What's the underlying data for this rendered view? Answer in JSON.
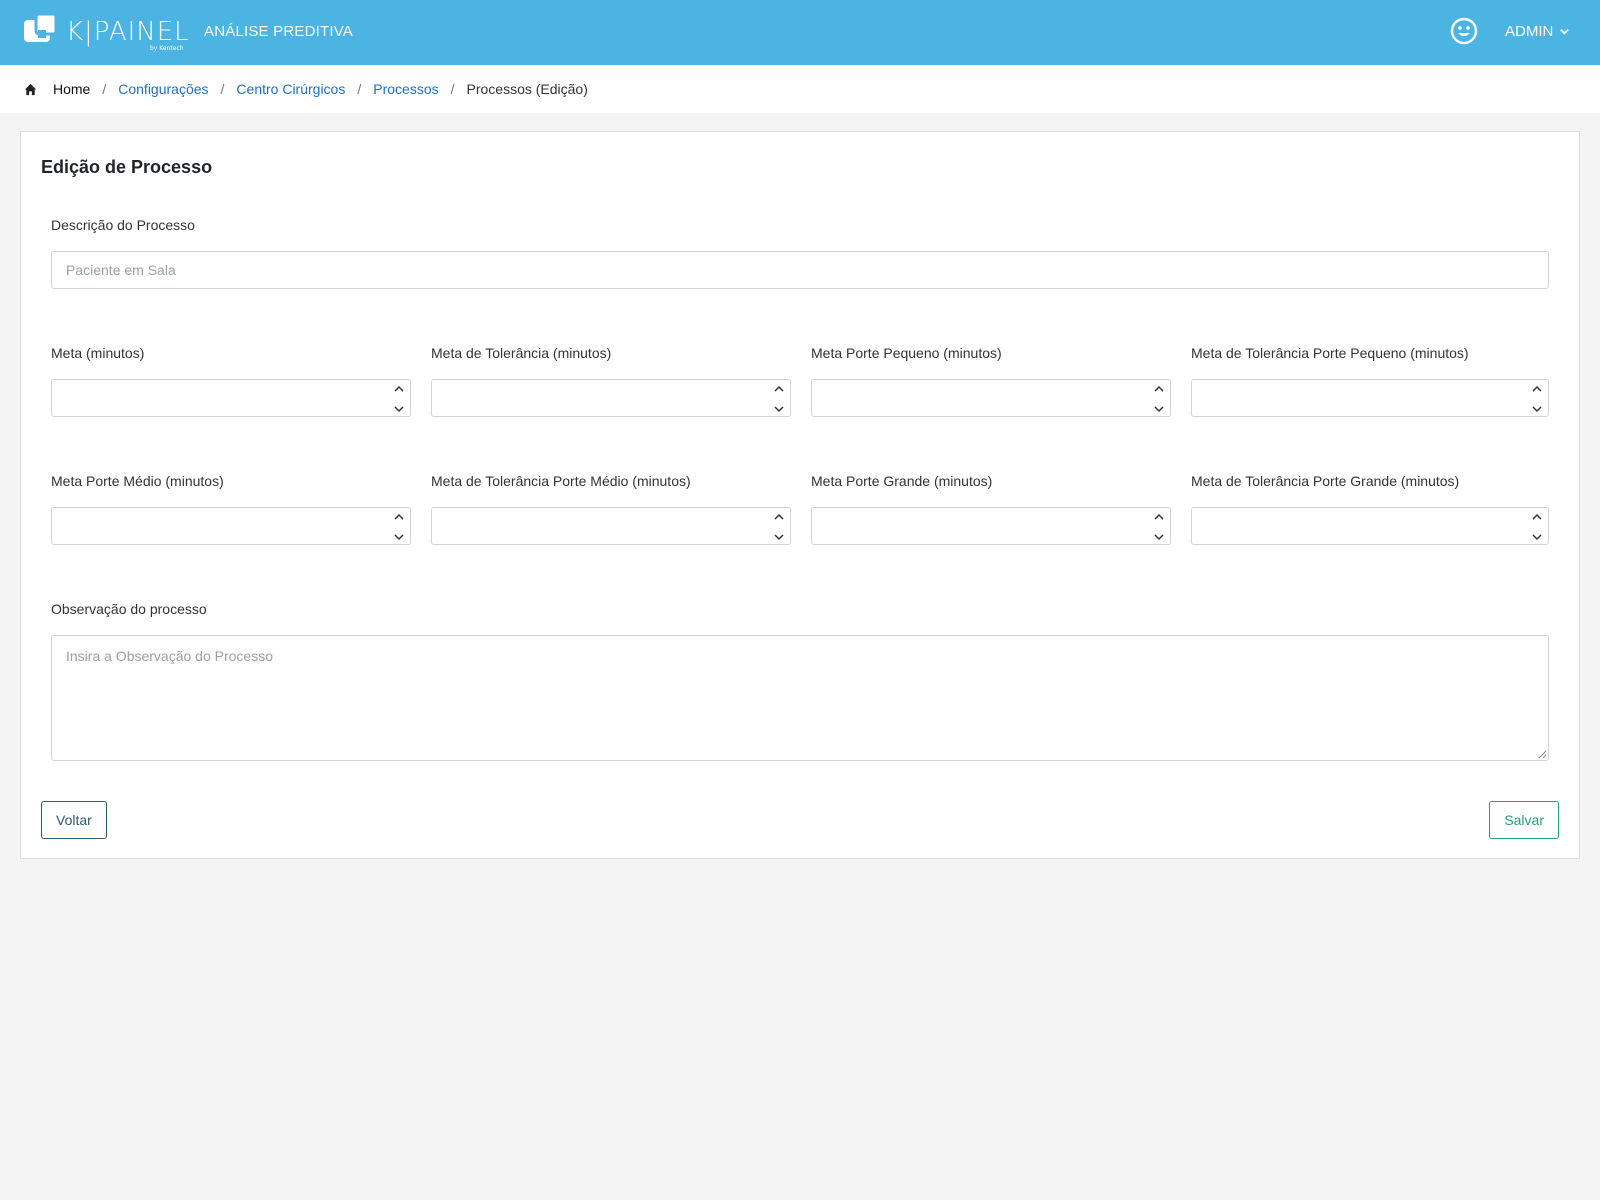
{
  "header": {
    "logo_text": "K|PAINEL",
    "logo_sub": "by Kentech",
    "app_title": "ANÁLISE PREDITIVA",
    "user_label": "ADMIN",
    "icons": {
      "profile": "smiley-face-icon",
      "dropdown": "chevron-down-icon"
    }
  },
  "breadcrumb": {
    "items": [
      "Home",
      "Configurações",
      "Centro Cirúrgicos",
      "Processos",
      "Processos (Edição)"
    ],
    "separator": "/"
  },
  "form": {
    "title": "Edição de Processo",
    "description": {
      "label": "Descrição do Processo",
      "value": "",
      "placeholder": "Paciente em Sala"
    },
    "numeric_fields": [
      {
        "label": "Meta (minutos)",
        "value": ""
      },
      {
        "label": "Meta de Tolerância (minutos)",
        "value": ""
      },
      {
        "label": "Meta Porte Pequeno (minutos)",
        "value": ""
      },
      {
        "label": "Meta de Tolerância Porte Pequeno (minutos)",
        "value": ""
      },
      {
        "label": "Meta Porte Médio (minutos)",
        "value": ""
      },
      {
        "label": "Meta de Tolerância Porte Médio (minutos)",
        "value": ""
      },
      {
        "label": "Meta Porte Grande (minutos)",
        "value": ""
      },
      {
        "label": "Meta de Tolerância Porte Grande (minutos)",
        "value": ""
      }
    ],
    "observation": {
      "label": "Observação do processo",
      "value": "",
      "placeholder": "Insira a Observação do Processo"
    },
    "back_label": "Voltar",
    "save_label": "Salvar"
  },
  "colors": {
    "topbar": "#4bb4e3",
    "link": "#1f6fc5",
    "back_button": "#2c5d6e",
    "save_button": "#28a070"
  }
}
